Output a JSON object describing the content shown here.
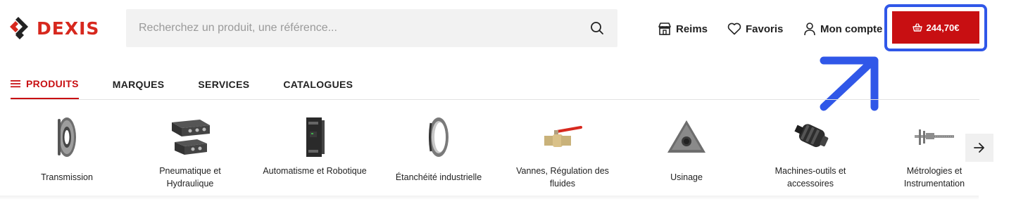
{
  "header": {
    "logo_text": "DEXIS",
    "search_placeholder": "Recherchez un produit, une référence...",
    "search_icon": "search-icon",
    "store_label": "Reims",
    "favorites_label": "Favoris",
    "account_label": "Mon compte",
    "cart_total": "244,70€",
    "brand_color": "#c80f12",
    "highlight_color": "#3057e8"
  },
  "nav": {
    "tabs": [
      {
        "label": "PRODUITS",
        "icon": "menu-icon",
        "active": true
      },
      {
        "label": "MARQUES"
      },
      {
        "label": "SERVICES"
      },
      {
        "label": "CATALOGUES"
      }
    ]
  },
  "categories": [
    {
      "label": "Transmission",
      "icon": "bearing-icon"
    },
    {
      "label": "Pneumatique et Hydraulique",
      "icon": "pneumatic-valve-icon"
    },
    {
      "label": "Automatisme et Robotique",
      "icon": "power-supply-icon"
    },
    {
      "label": "Étanchéité industrielle",
      "icon": "seal-ring-icon"
    },
    {
      "label": "Vannes, Régulation des fluides",
      "icon": "ball-valve-icon"
    },
    {
      "label": "Usinage",
      "icon": "cutting-insert-icon"
    },
    {
      "label": "Machines-outils et accessoires",
      "icon": "drill-chuck-icon"
    },
    {
      "label": "Métrologies et Instrumentation",
      "icon": "caliper-icon"
    }
  ]
}
